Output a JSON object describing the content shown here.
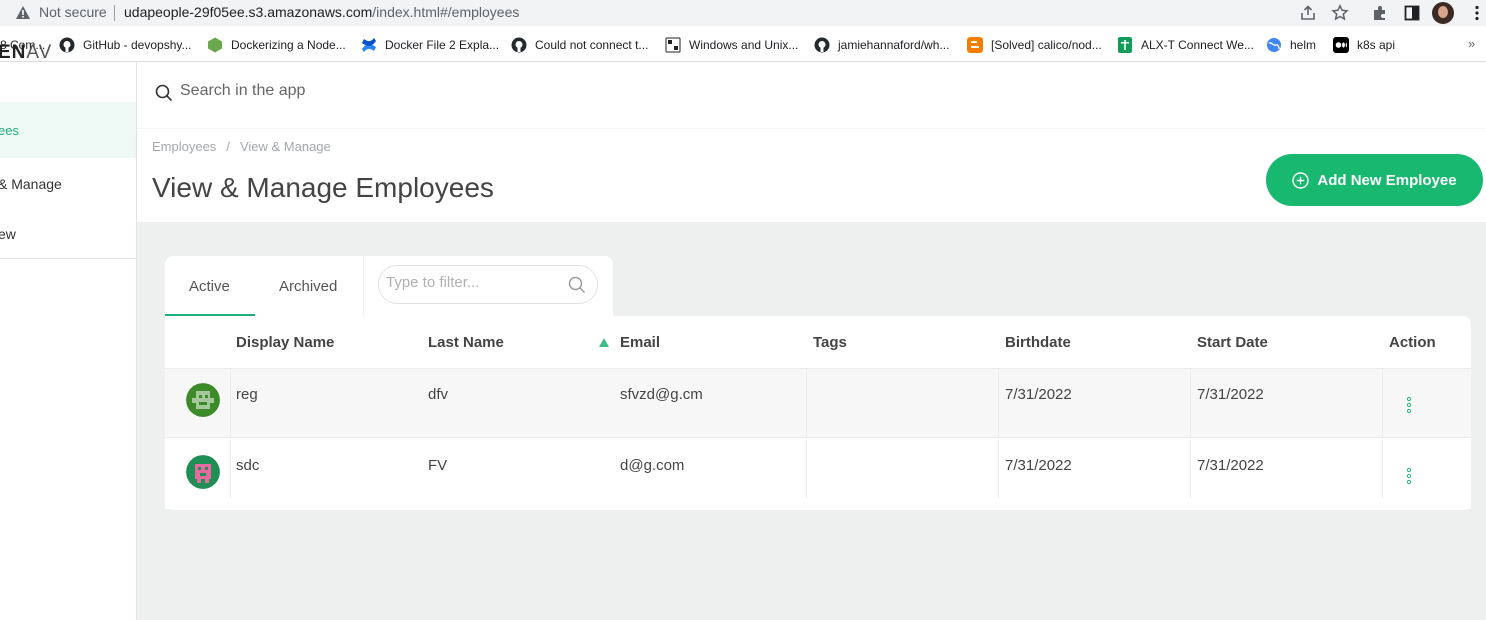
{
  "browser": {
    "security_label": "Not secure",
    "url_host": "udapeople-29f05ee.s3.amazonaws.com",
    "url_path": "/index.html#/employees"
  },
  "bookmarks": [
    {
      "label": "8 Com...",
      "icon": "bookmark-icon",
      "color": "#4a4a4a"
    },
    {
      "label": "GitHub - devopshy...",
      "icon": "github-icon",
      "color": "#24292e"
    },
    {
      "label": "Dockerizing a Node...",
      "icon": "nodejs-icon",
      "color": "#6aa84f"
    },
    {
      "label": "Docker File 2 Expla...",
      "icon": "confluence-icon",
      "color": "#2684ff"
    },
    {
      "label": "Could not connect t...",
      "icon": "github-icon",
      "color": "#24292e"
    },
    {
      "label": "Windows and Unix...",
      "icon": "site-icon",
      "color": "#222222"
    },
    {
      "label": "jamiehannaford/wh...",
      "icon": "github-icon",
      "color": "#24292e"
    },
    {
      "label": "[Solved] calico/nod...",
      "icon": "blogger-icon",
      "color": "#f57d00"
    },
    {
      "label": "ALX-T Connect We...",
      "icon": "sheets-icon",
      "color": "#0f9d58"
    },
    {
      "label": "helm",
      "icon": "globe-icon",
      "color": "#4285f4"
    },
    {
      "label": "k8s api",
      "icon": "medium-icon",
      "color": "#000000"
    }
  ],
  "sidebar": {
    "logo_bold": "EN",
    "logo_thin": "AV",
    "active_label": "ees",
    "items": [
      {
        "label": "& Manage"
      },
      {
        "label": "ew"
      }
    ]
  },
  "search": {
    "placeholder": "Search in the app"
  },
  "header": {
    "breadcrumb_root": "Employees",
    "breadcrumb_sep": "/",
    "breadcrumb_current": "View & Manage",
    "title": "View & Manage Employees",
    "add_button_label": "Add New Employee"
  },
  "tabs": {
    "active": "Active",
    "archived": "Archived",
    "filter_placeholder": "Type to filter..."
  },
  "table": {
    "columns": [
      "Display Name",
      "Last Name",
      "Email",
      "Tags",
      "Birthdate",
      "Start Date",
      "Action"
    ],
    "sorted_column": "Email",
    "rows": [
      {
        "display_name": "reg",
        "last_name": "dfv",
        "email": "sfvzd@g.cm",
        "tags": "",
        "birthdate": "7/31/2022",
        "start_date": "7/31/2022",
        "avatar_color": "#3d8a2a"
      },
      {
        "display_name": "sdc",
        "last_name": "FV",
        "email": "d@g.com",
        "tags": "",
        "birthdate": "7/31/2022",
        "start_date": "7/31/2022",
        "avatar_color": "#e66aa0"
      }
    ]
  },
  "colors": {
    "accent": "#19b870",
    "background": "#eef0f0"
  }
}
